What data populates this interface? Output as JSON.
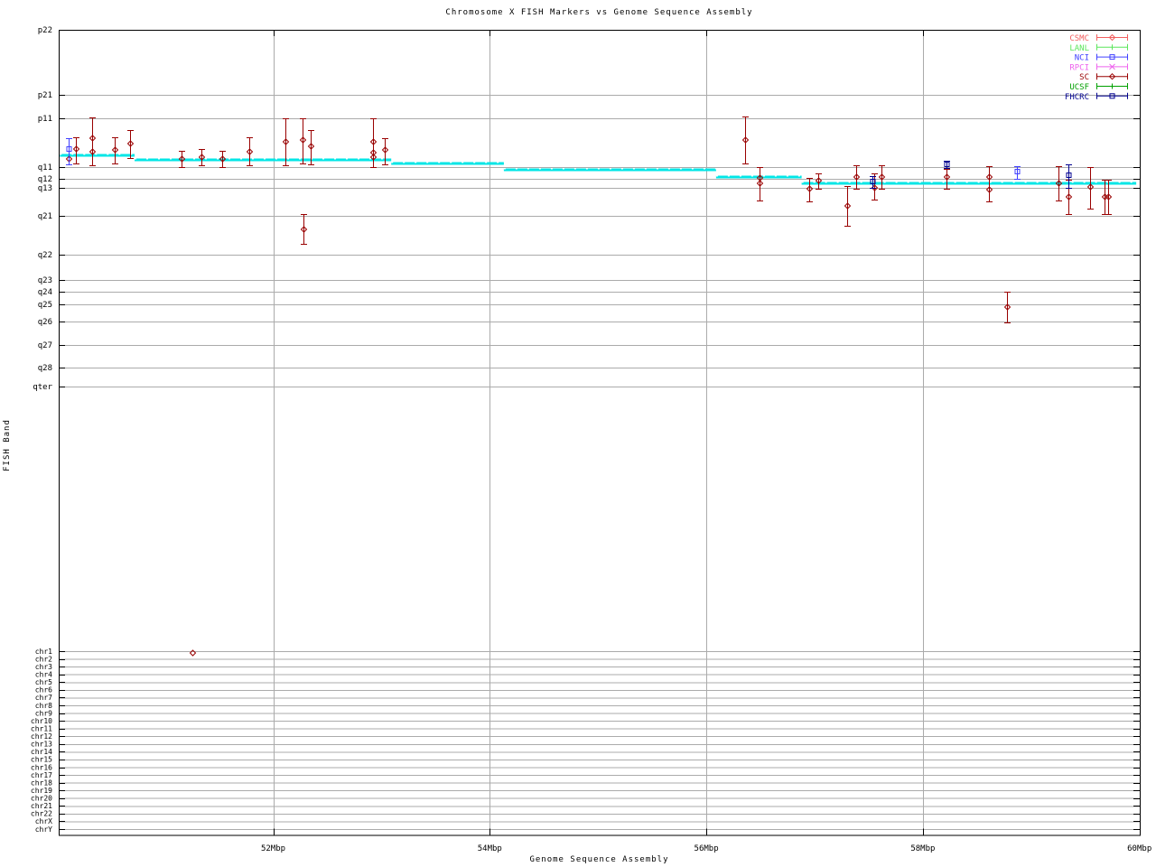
{
  "chart_data": {
    "type": "scatter",
    "title": "Chromosome X FISH Markers vs Genome Sequence Assembly",
    "xlabel": "Genome Sequence Assembly",
    "ylabel": "FISH Band",
    "grid": true,
    "legend_position": "top-right",
    "x_axis": {
      "unit": "Mbp",
      "range_mbp": [
        50.02,
        60.0
      ],
      "ticks": [
        {
          "label": "52Mbp",
          "mbp": 52
        },
        {
          "label": "54Mbp",
          "mbp": 54
        },
        {
          "label": "56Mbp",
          "mbp": 56
        },
        {
          "label": "58Mbp",
          "mbp": 58
        },
        {
          "label": "60Mbp",
          "mbp": 60
        }
      ]
    },
    "y_axis": {
      "kind": "FISH band categories (pixel positions on band axis)",
      "bands": [
        [
          "p22",
          33
        ],
        [
          "p21",
          105
        ],
        [
          "p11",
          131
        ],
        [
          "q11",
          185
        ],
        [
          "q12",
          198
        ],
        [
          "q13",
          208
        ],
        [
          "q21",
          239
        ],
        [
          "q22",
          282
        ],
        [
          "q23",
          310
        ],
        [
          "q24",
          323
        ],
        [
          "q25",
          337
        ],
        [
          "q26",
          356
        ],
        [
          "q27",
          382
        ],
        [
          "q28",
          407
        ],
        [
          "qter",
          428
        ]
      ],
      "chromosomes": [
        [
          "chr1",
          721.0
        ],
        [
          "chr2",
          729.6
        ],
        [
          "chr3",
          738.1
        ],
        [
          "chr4",
          746.7
        ],
        [
          "chr5",
          755.3
        ],
        [
          "chr6",
          763.8
        ],
        [
          "chr7",
          772.4
        ],
        [
          "chr8",
          781.0
        ],
        [
          "chr9",
          789.5
        ],
        [
          "chr10",
          798.1
        ],
        [
          "chr11",
          806.7
        ],
        [
          "chr12",
          815.2
        ],
        [
          "chr13",
          823.8
        ],
        [
          "chr14",
          832.3
        ],
        [
          "chr15",
          840.9
        ],
        [
          "chr16",
          849.5
        ],
        [
          "chr17",
          858.0
        ],
        [
          "chr18",
          866.6
        ],
        [
          "chr19",
          875.2
        ],
        [
          "chr20",
          883.7
        ],
        [
          "chr21",
          892.3
        ],
        [
          "chr22",
          900.9
        ],
        [
          "chrX",
          909.4
        ],
        [
          "chrY",
          918.0
        ]
      ]
    },
    "assembly_line": {
      "name": "assembly band position",
      "color": "#00e6e6",
      "segments_x1_x2_mbp_ypx": [
        [
          50.03,
          50.72,
          172
        ],
        [
          50.72,
          53.09,
          177
        ],
        [
          53.09,
          54.13,
          181
        ],
        [
          54.13,
          56.09,
          188
        ],
        [
          56.09,
          56.88,
          196
        ],
        [
          56.88,
          59.97,
          203
        ]
      ]
    },
    "series": [
      {
        "name": "CSMC",
        "color": "#f26060",
        "marker": "diamond",
        "points": []
      },
      {
        "name": "LANL",
        "color": "#5ce65c",
        "marker": "vtick",
        "points": []
      },
      {
        "name": "SC",
        "color": "#990000",
        "marker": "diamond",
        "points": [
          [
            50.11,
            176,
            null,
            null
          ],
          [
            50.18,
            165,
            152,
            181
          ],
          [
            50.33,
            153,
            130,
            183
          ],
          [
            50.33,
            168,
            null,
            null
          ],
          [
            50.54,
            166,
            152,
            181
          ],
          [
            50.68,
            159,
            144,
            175
          ],
          [
            51.15,
            176,
            167,
            185
          ],
          [
            51.25,
            723,
            null,
            null
          ],
          [
            51.34,
            174,
            165,
            183
          ],
          [
            51.53,
            176,
            167,
            185
          ],
          [
            51.78,
            168,
            152,
            183
          ],
          [
            52.11,
            157,
            131,
            183
          ],
          [
            52.27,
            155,
            131,
            181
          ],
          [
            52.28,
            254,
            237,
            270
          ],
          [
            52.35,
            162,
            144,
            182
          ],
          [
            52.92,
            157,
            131,
            185
          ],
          [
            52.92,
            169,
            null,
            null
          ],
          [
            52.92,
            174,
            null,
            null
          ],
          [
            53.03,
            166,
            153,
            182
          ],
          [
            56.36,
            155,
            129,
            181
          ],
          [
            56.49,
            197,
            185,
            222
          ],
          [
            56.49,
            203,
            null,
            null
          ],
          [
            56.95,
            209,
            197,
            223
          ],
          [
            57.03,
            200,
            192,
            209
          ],
          [
            57.3,
            228,
            206,
            250
          ],
          [
            57.38,
            196,
            183,
            209
          ],
          [
            57.55,
            208,
            192,
            221
          ],
          [
            57.62,
            196,
            183,
            209
          ],
          [
            58.22,
            196,
            187,
            209
          ],
          [
            58.61,
            196,
            184,
            223
          ],
          [
            58.61,
            210,
            null,
            null
          ],
          [
            58.78,
            340,
            323,
            357
          ],
          [
            59.25,
            203,
            184,
            222
          ],
          [
            59.34,
            218,
            199,
            237
          ],
          [
            59.54,
            207,
            185,
            231
          ],
          [
            59.68,
            218,
            199,
            237
          ],
          [
            59.71,
            218,
            199,
            237
          ]
        ]
      },
      {
        "name": "RPCI",
        "color": "#ee63ee",
        "marker": "cross",
        "points": []
      },
      {
        "name": "NCI",
        "color": "#4040ff",
        "marker": "square",
        "points": [
          [
            50.11,
            165,
            153,
            182
          ],
          [
            58.87,
            190,
            184,
            198
          ]
        ]
      },
      {
        "name": "UCSF",
        "color": "#00a000",
        "marker": "vtick",
        "points": []
      },
      {
        "name": "FHCRC",
        "color": "#000090",
        "marker": "square",
        "points": [
          [
            57.53,
            201,
            195,
            208
          ],
          [
            58.22,
            182,
            178,
            186
          ],
          [
            59.34,
            194,
            182,
            208
          ]
        ]
      }
    ],
    "legend_order": [
      "CSMC",
      "LANL",
      "NCI",
      "RPCI",
      "SC",
      "UCSF",
      "FHCRC"
    ]
  }
}
